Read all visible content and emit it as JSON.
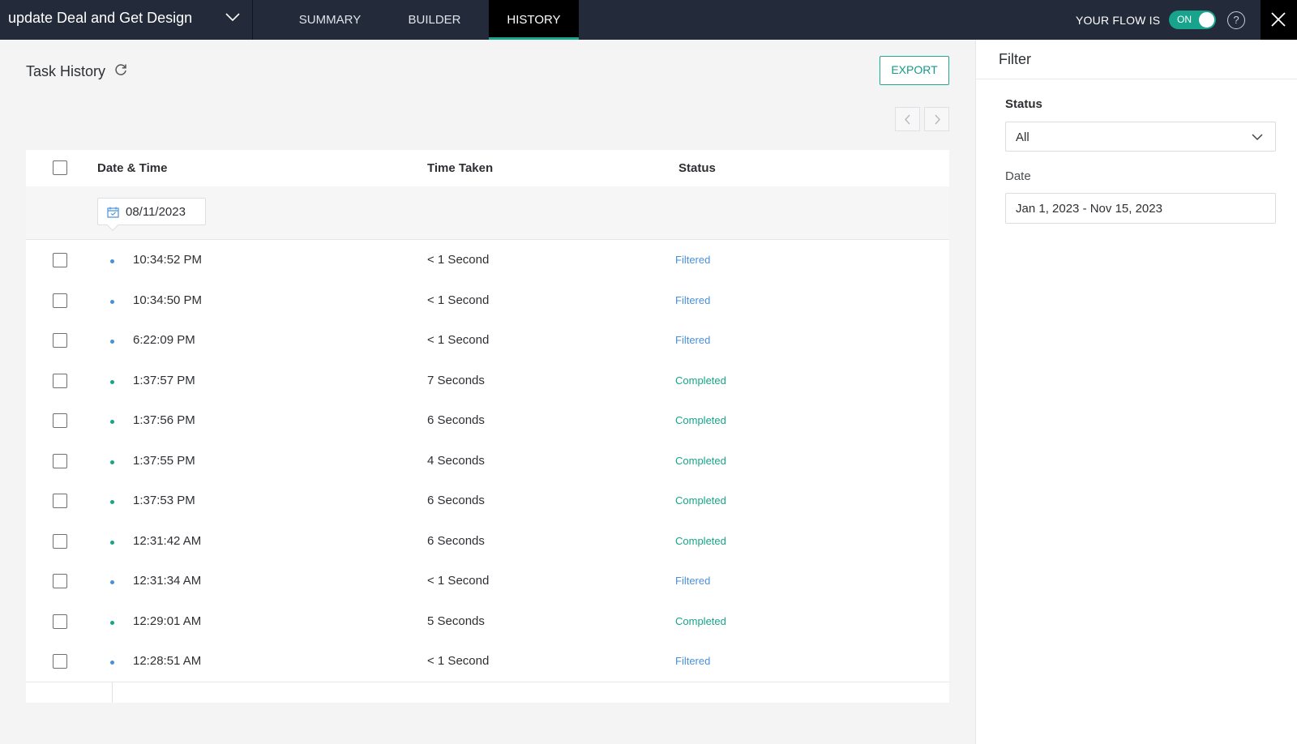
{
  "header": {
    "flow_name": "update Deal and Get Design",
    "tabs": [
      {
        "label": "SUMMARY",
        "active": false
      },
      {
        "label": "BUILDER",
        "active": false
      },
      {
        "label": "HISTORY",
        "active": true
      }
    ],
    "flow_status_label": "YOUR FLOW IS",
    "toggle_label": "ON",
    "help_label": "?"
  },
  "main": {
    "title": "Task History",
    "export_label": "EXPORT",
    "table": {
      "columns": [
        "Date & Time",
        "Time Taken",
        "Status"
      ],
      "group_date": "08/11/2023",
      "rows": [
        {
          "time": "10:34:52 PM",
          "taken": "< 1 Second",
          "status": "Filtered"
        },
        {
          "time": "10:34:50 PM",
          "taken": "< 1 Second",
          "status": "Filtered"
        },
        {
          "time": "6:22:09 PM",
          "taken": "< 1 Second",
          "status": "Filtered"
        },
        {
          "time": "1:37:57 PM",
          "taken": "7 Seconds",
          "status": "Completed"
        },
        {
          "time": "1:37:56 PM",
          "taken": "6 Seconds",
          "status": "Completed"
        },
        {
          "time": "1:37:55 PM",
          "taken": "4 Seconds",
          "status": "Completed"
        },
        {
          "time": "1:37:53 PM",
          "taken": "6 Seconds",
          "status": "Completed"
        },
        {
          "time": "12:31:42 AM",
          "taken": "6 Seconds",
          "status": "Completed"
        },
        {
          "time": "12:31:34 AM",
          "taken": "< 1 Second",
          "status": "Filtered"
        },
        {
          "time": "12:29:01 AM",
          "taken": "5 Seconds",
          "status": "Completed"
        },
        {
          "time": "12:28:51 AM",
          "taken": "< 1 Second",
          "status": "Filtered"
        }
      ]
    }
  },
  "filter": {
    "title": "Filter",
    "status_label": "Status",
    "status_value": "All",
    "date_label": "Date",
    "date_value": "Jan 1, 2023 - Nov 15, 2023"
  },
  "colors": {
    "filtered": "#4a90d9",
    "completed": "#17a589",
    "accent": "#18a38c",
    "topbar": "#232a3a"
  },
  "icons": [
    "chevron-down-icon",
    "refresh-icon",
    "chevron-left-icon",
    "chevron-right-icon",
    "calendar-icon",
    "help-icon",
    "close-icon"
  ]
}
